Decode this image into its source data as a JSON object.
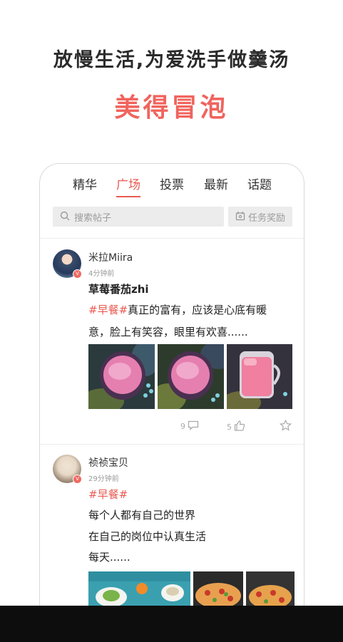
{
  "promo": {
    "headline": "放慢生活,为爱洗手做羹汤",
    "subheadline": "美得冒泡"
  },
  "tabs": [
    {
      "label": "精华",
      "active": false
    },
    {
      "label": "广场",
      "active": true
    },
    {
      "label": "投票",
      "active": false
    },
    {
      "label": "最新",
      "active": false
    },
    {
      "label": "话题",
      "active": false
    }
  ],
  "search": {
    "placeholder": "搜索帖子",
    "icon": "search-icon"
  },
  "task": {
    "label": "任务奖励",
    "icon": "gift-calendar-icon"
  },
  "posts": [
    {
      "username": "米拉Miira",
      "time": "4分钟前",
      "title": "草莓番茄zhi",
      "tag": "#早餐#",
      "line1": "真正的富有，应该是心底有暖",
      "line2": "意，脸上有笑容，眼里有欢喜......",
      "comments": "9",
      "likes": "5"
    },
    {
      "username": "祯祯宝贝",
      "time": "29分钟前",
      "tag": "#早餐#",
      "line1": "每个人都有自己的世界",
      "line2": "在自己的岗位中认真生活",
      "line3": "每天......"
    }
  ],
  "colors": {
    "accent": "#e95b53",
    "brand_red": "#f0645e"
  }
}
